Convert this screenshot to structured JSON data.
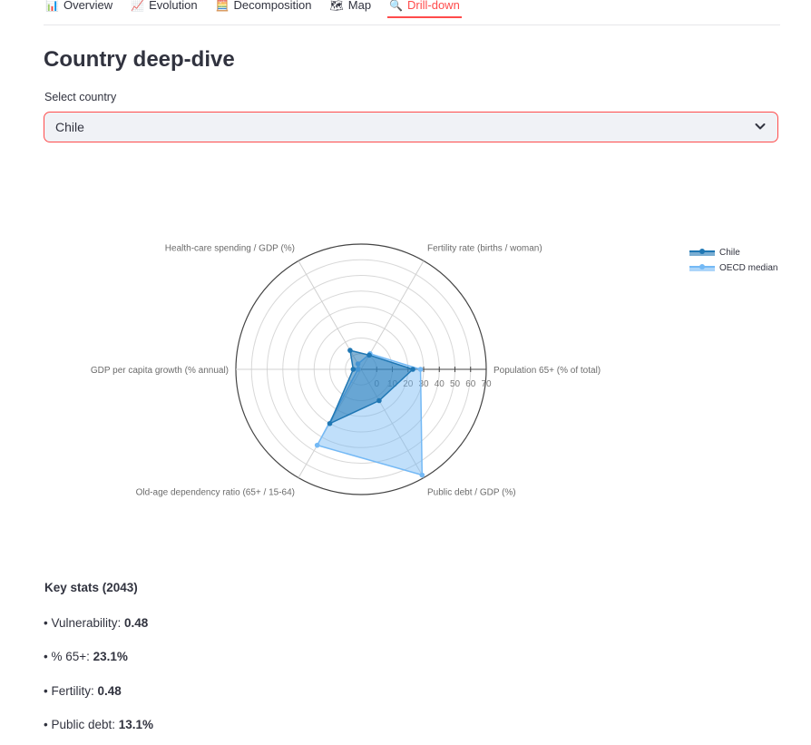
{
  "tabs": [
    {
      "icon": "📊",
      "label": "Overview"
    },
    {
      "icon": "📈",
      "label": "Evolution"
    },
    {
      "icon": "🧮",
      "label": "Decomposition"
    },
    {
      "icon": "🗺",
      "label": "Map"
    },
    {
      "icon": "🔍",
      "label": "Drill-down"
    }
  ],
  "active_tab": "Drill-down",
  "page_title": "Country deep-dive",
  "select": {
    "label": "Select country",
    "value": "Chile"
  },
  "chart_data": {
    "type": "radar",
    "axes": [
      "Population 65+ (% of total)",
      "Public debt / GDP (%)",
      "Old-age dependency ratio (65+ / 15-64)",
      "GDP per capita growth (% annual)",
      "Health-care spending / GDP (%)",
      "Fertility rate (births / woman)"
    ],
    "radial_range": [
      -10,
      70
    ],
    "radial_ticks": [
      0,
      10,
      20,
      30,
      40,
      50,
      60,
      70
    ],
    "series": [
      {
        "name": "Chile",
        "values": [
          23.1,
          13.1,
          30,
          -5,
          4,
          0.48
        ],
        "color": "#1f77b4"
      },
      {
        "name": "OECD median",
        "values": [
          28,
          68,
          46,
          -8,
          -6,
          1.5
        ],
        "color": "#74b9f5"
      }
    ],
    "legend_position": "top-right"
  },
  "stats": {
    "title": "Key stats (2043)",
    "items": [
      {
        "label": "• Vulnerability: ",
        "value": "0.48"
      },
      {
        "label": "• % 65+: ",
        "value": "23.1%"
      },
      {
        "label": "• Fertility: ",
        "value": "0.48"
      },
      {
        "label": "• Public debt: ",
        "value": "13.1%"
      }
    ]
  }
}
